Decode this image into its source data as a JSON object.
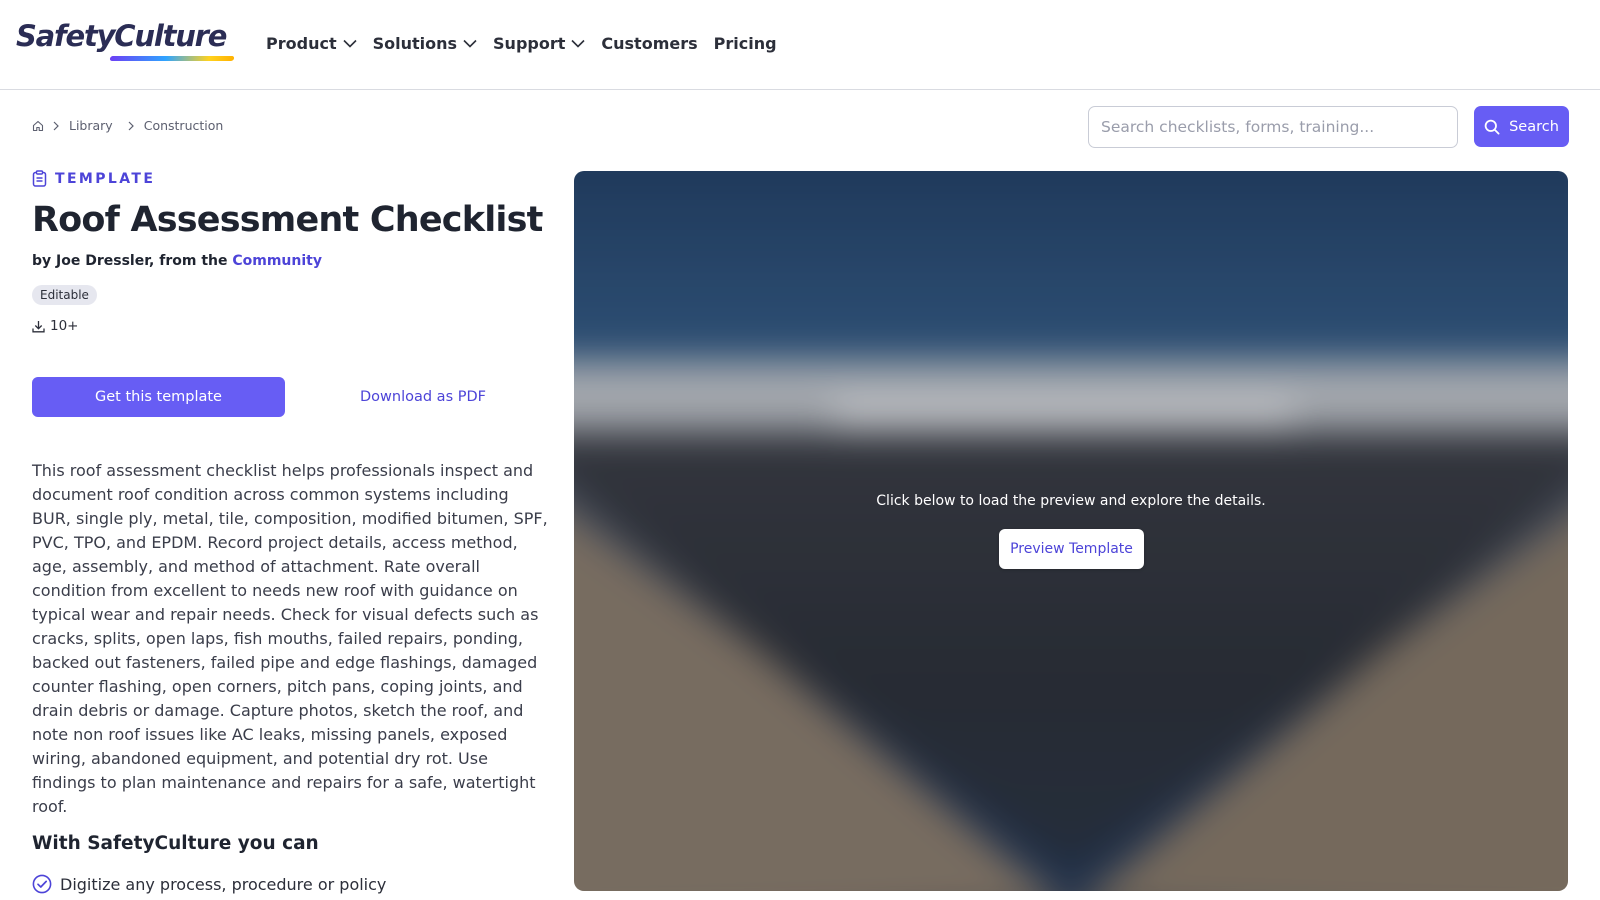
{
  "header": {
    "logo_text": "SafetyCulture",
    "nav": [
      {
        "label": "Product",
        "dropdown": true
      },
      {
        "label": "Solutions",
        "dropdown": true
      },
      {
        "label": "Support",
        "dropdown": true
      },
      {
        "label": "Customers",
        "dropdown": false
      },
      {
        "label": "Pricing",
        "dropdown": false
      }
    ]
  },
  "breadcrumb": {
    "home_icon": "home-icon",
    "items": [
      "Library",
      "Construction"
    ]
  },
  "search": {
    "placeholder": "Search checklists, forms, training...",
    "button_label": "Search"
  },
  "template": {
    "type_label": "TEMPLATE",
    "title": "Roof Assessment Checklist",
    "byline_prefix": "by Joe Dressler, from the ",
    "byline_link": "Community",
    "badge": "Editable",
    "downloads": "10+",
    "primary_button": "Get this template",
    "secondary_button": "Download as PDF",
    "description": "This roof assessment checklist helps professionals inspect and document roof condition across common systems including BUR, single ply, metal, tile, composition, modified bitumen, SPF, PVC, TPO, and EPDM. Record project details, access method, age, assembly, and method of attachment. Rate overall condition from excellent to needs new roof with guidance on typical wear and repair needs. Check for visual defects such as cracks, splits, open laps, fish mouths, failed repairs, ponding, backed out fasteners, failed pipe and edge flashings, damaged counter flashing, open corners, pitch pans, coping joints, and drain debris or damage. Capture photos, sketch the roof, and note non roof issues like AC leaks, missing panels, exposed wiring, abandoned equipment, and potential dry rot. Use findings to plan maintenance and repairs for a safe, watertight roof."
  },
  "benefits": {
    "heading": "With SafetyCulture you can",
    "items": [
      "Digitize any process, procedure or policy"
    ]
  },
  "preview": {
    "message": "Click below to load the preview and explore the details.",
    "button_label": "Preview Template"
  },
  "colors": {
    "brand": "#675df4",
    "link": "#4d44d8",
    "text": "#1f2430"
  }
}
